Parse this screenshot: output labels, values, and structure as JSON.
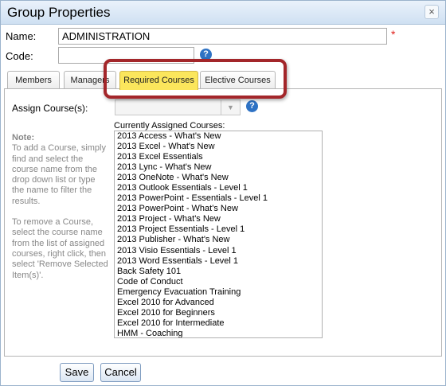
{
  "dialog": {
    "title": "Group Properties",
    "close_glyph": "×"
  },
  "form": {
    "name_label": "Name:",
    "name_value": "ADMINISTRATION",
    "required_marker": "*",
    "code_label": "Code:",
    "code_value": "",
    "help_glyph": "?"
  },
  "tabs": [
    {
      "label": "Members",
      "active": false
    },
    {
      "label": "Managers",
      "active": false
    },
    {
      "label": "Required Courses",
      "active": true
    },
    {
      "label": "Elective Courses",
      "active": false
    }
  ],
  "required_courses": {
    "assign_label": "Assign Course(s):",
    "assign_value": "",
    "assigned_label": "Currently Assigned Courses:",
    "note_title": "Note:",
    "note_add": "To add a Course, simply find and select the course name from the drop down list or type the name to filter the results.",
    "note_remove": "To remove a Course, select the course name from the list of assigned courses, right click, then select 'Remove Selected Item(s)'.",
    "courses": [
      "2013 Access - What's New",
      "2013 Excel - What's New",
      "2013 Excel Essentials",
      "2013 Lync - What's New",
      "2013 OneNote - What's New",
      "2013 Outlook Essentials - Level 1",
      "2013 PowerPoint - Essentials - Level 1",
      "2013 PowerPoint - What's New",
      "2013 Project - What's New",
      "2013 Project Essentials - Level 1",
      "2013 Publisher - What's New",
      "2013 Visio Essentials - Level 1",
      "2013 Word Essentials - Level 1",
      "Back Safety 101",
      "Code of Conduct",
      "Emergency Evacuation Training",
      "Excel 2010 for Advanced",
      "Excel 2010 for Beginners",
      "Excel 2010 for Intermediate",
      "HMM - Coaching"
    ]
  },
  "buttons": {
    "save": "Save",
    "cancel": "Cancel"
  },
  "colors": {
    "active_tab": "#fbe65c",
    "highlight_border": "#a3262a",
    "required": "#e0201b",
    "help": "#2e72c4"
  }
}
